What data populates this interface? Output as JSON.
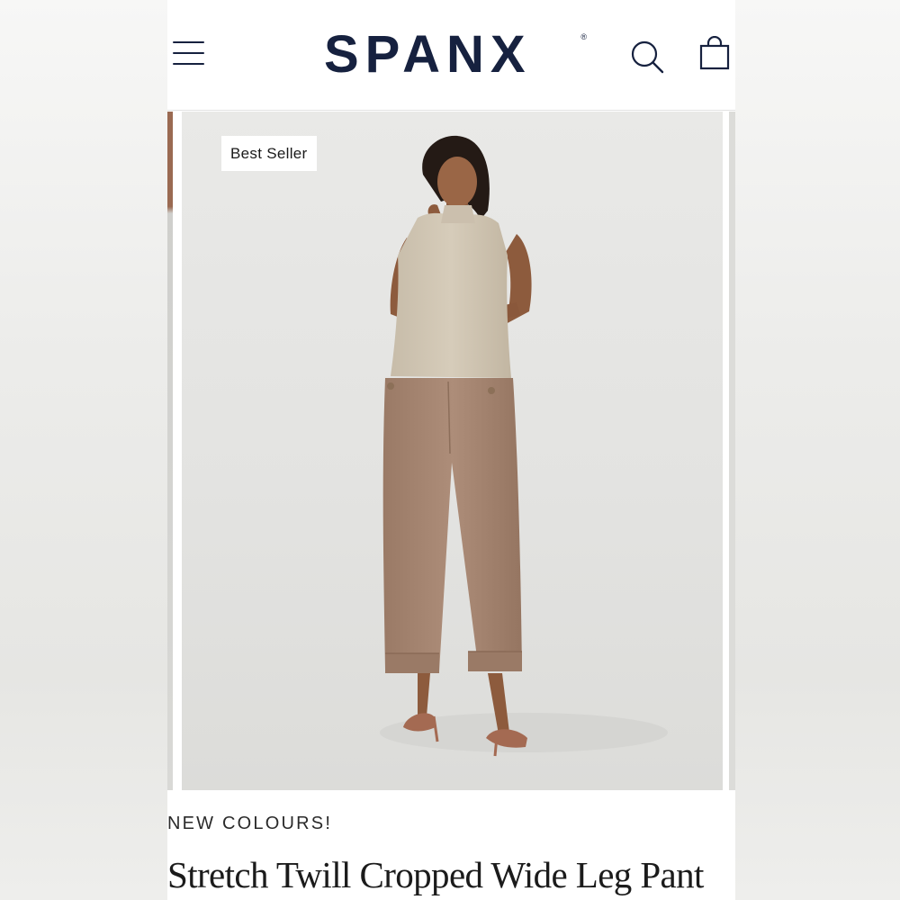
{
  "header": {
    "logo_text": "SPANX",
    "logo_mark": "®",
    "menu_icon": "hamburger-menu-icon",
    "search_icon": "search-icon",
    "bag_icon": "shopping-bag-icon"
  },
  "carousel": {
    "badge": "Best Seller"
  },
  "product": {
    "tagline": "NEW COLOURS!",
    "title": "Stretch Twill Cropped Wide Leg Pant"
  },
  "colors": {
    "brand_navy": "#16213f",
    "background": "#ffffff",
    "pant_color": "#a68672",
    "top_color": "#cfc5b3"
  }
}
